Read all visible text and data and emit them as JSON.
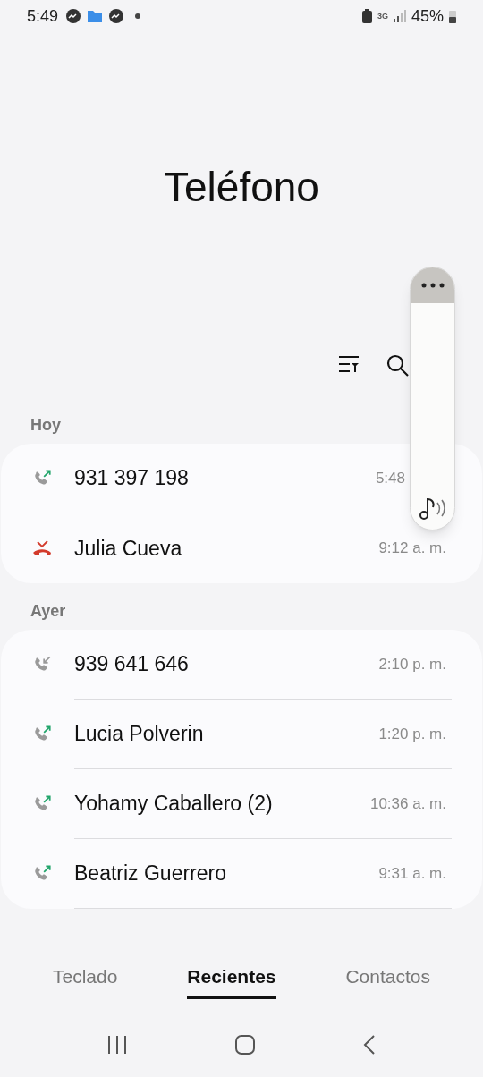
{
  "status_bar": {
    "time": "5:49",
    "network": "3G",
    "battery": "45%"
  },
  "title": "Teléfono",
  "sections": [
    {
      "header": "Hoy",
      "calls": [
        {
          "kind": "outgoing",
          "name": "931 397 198",
          "time": "5:48"
        },
        {
          "kind": "missed",
          "name": "Julia Cueva",
          "time": "9:12 a. m."
        }
      ]
    },
    {
      "header": "Ayer",
      "calls": [
        {
          "kind": "incoming",
          "name": "939 641 646",
          "time": "2:10 p. m."
        },
        {
          "kind": "outgoing",
          "name": "Lucia Polverin",
          "time": "1:20 p. m."
        },
        {
          "kind": "outgoing",
          "name": "Yohamy Caballero (2)",
          "time": "10:36 a. m."
        },
        {
          "kind": "outgoing",
          "name": "Beatriz Guerrero",
          "time": "9:31 a. m."
        }
      ]
    }
  ],
  "tabs": [
    {
      "label": "Teclado",
      "selected": false
    },
    {
      "label": "Recientes",
      "selected": true
    },
    {
      "label": "Contactos",
      "selected": false
    }
  ]
}
